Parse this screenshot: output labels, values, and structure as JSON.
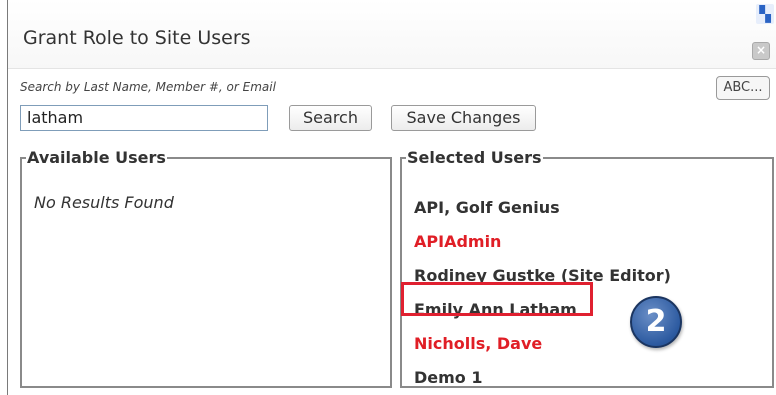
{
  "dialog": {
    "title": "Grant Role to Site Users",
    "close_glyph": "×",
    "corner_icon": "app-logo-icon"
  },
  "search": {
    "label": "Search by Last Name, Member #, or Email",
    "value": "latham",
    "search_button": "Search",
    "save_button": "Save Changes",
    "abc_button": "ABC..."
  },
  "available": {
    "legend": "Available Users",
    "empty_text": "No Results Found"
  },
  "selected": {
    "legend": "Selected Users",
    "users": [
      {
        "label": "API, Golf Genius",
        "color": "#333333"
      },
      {
        "label": "APIAdmin",
        "color": "#e01e26"
      },
      {
        "label": "Rodiney Gustke (Site Editor)",
        "color": "#333333"
      },
      {
        "label": "Emily Ann Latham",
        "color": "#333333"
      },
      {
        "label": "Nicholls, Dave",
        "color": "#e01e26"
      },
      {
        "label": "Demo 1",
        "color": "#333333"
      }
    ]
  },
  "annotation": {
    "step_number": "2",
    "highlight_color": "#e02030",
    "badge_color": "#2c5aa0"
  }
}
